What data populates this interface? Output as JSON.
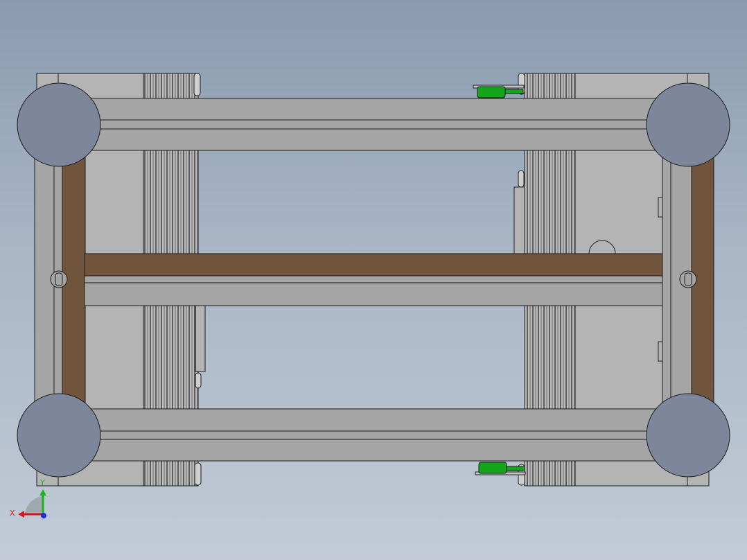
{
  "viewport": {
    "background_top": "#8a9bb0",
    "background_bottom": "#c2cbd6"
  },
  "model": {
    "frame_color": "#a5a5a5",
    "plate_color": "#b4b4b4",
    "wood_color": "#70543b",
    "wheel_color": "#7e869c",
    "cylinder_color": "#13a61a",
    "edge_color": "#1a1a1a"
  },
  "triad": {
    "x_label": "X",
    "y_label": "Y",
    "x_color": "#d01818",
    "y_color": "#19b419",
    "z_color": "#1c2ee0"
  }
}
